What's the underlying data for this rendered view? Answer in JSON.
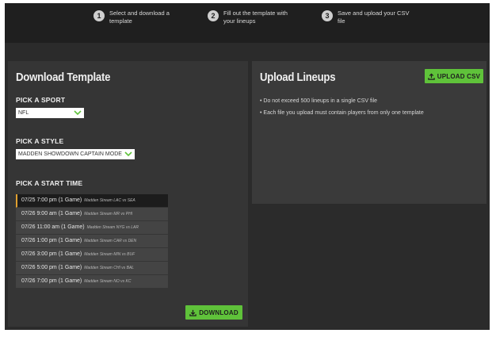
{
  "steps": [
    {
      "num": "1",
      "text": "Select and download a template"
    },
    {
      "num": "2",
      "text": "Fill out the template with your lineups"
    },
    {
      "num": "3",
      "text": "Save and upload your CSV file"
    }
  ],
  "download": {
    "title": "Download Template",
    "sport_label": "PICK A SPORT",
    "sport_value": "NFL",
    "style_label": "PICK A STYLE",
    "style_value": "MADDEN SHOWDOWN CAPTAIN MODE",
    "start_label": "PICK A START TIME",
    "times": [
      {
        "time": "07/25 7:00 pm (1 Game)",
        "sub": "Madden Stream LAC vs SEA",
        "selected": true
      },
      {
        "time": "07/26 9:00 am (1 Game)",
        "sub": "Madden Stream MR vs PHI",
        "selected": false
      },
      {
        "time": "07/26 11:00 am (1 Game)",
        "sub": "Madden Stream NYG vs LAR",
        "selected": false
      },
      {
        "time": "07/26 1:00 pm (1 Game)",
        "sub": "Madden Stream CAR vs DEN",
        "selected": false
      },
      {
        "time": "07/26 3:00 pm (1 Game)",
        "sub": "Madden Stream MIN vs BUF",
        "selected": false
      },
      {
        "time": "07/26 5:00 pm (1 Game)",
        "sub": "Madden Stream CHI vs BAL",
        "selected": false
      },
      {
        "time": "07/26 7:00 pm (1 Game)",
        "sub": "Madden Stream NO vs KC",
        "selected": false
      }
    ],
    "button_label": "DOWNLOAD"
  },
  "upload": {
    "title": "Upload Lineups",
    "button_label": "UPLOAD CSV",
    "notes": [
      "• Do not exceed 500 lineups in a single CSV file",
      "• Each file you upload must contain players from only one template"
    ]
  },
  "colors": {
    "accent_green": "#5fc23a",
    "selected_marker": "#e0a030"
  },
  "icons": {
    "download": "download-icon",
    "upload": "upload-icon",
    "chevron": "chevron-down-icon"
  }
}
